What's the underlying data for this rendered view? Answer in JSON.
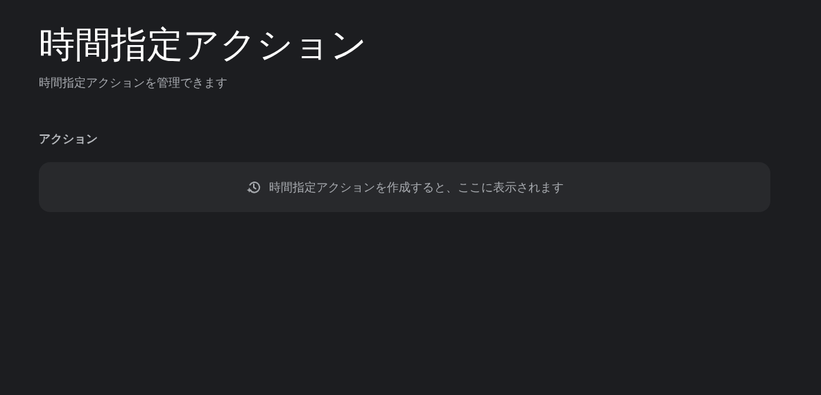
{
  "page": {
    "title": "時間指定アクション",
    "subtitle": "時間指定アクションを管理できます"
  },
  "section": {
    "heading": "アクション",
    "empty_message": "時間指定アクションを作成すると、ここに表示されます"
  }
}
